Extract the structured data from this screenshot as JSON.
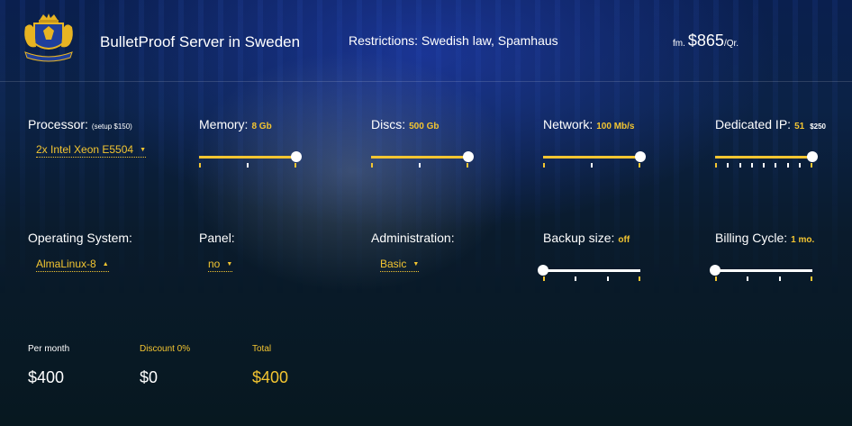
{
  "header": {
    "title": "BulletProof Server in Sweden",
    "restrictions": "Restrictions: Swedish law, Spamhaus",
    "price_prefix": "fm.",
    "price_amount": "$865",
    "price_period": "/Qr."
  },
  "config": {
    "processor": {
      "label": "Processor:",
      "note": "(setup $150)",
      "selected": "2x Intel Xeon E5504"
    },
    "memory": {
      "label": "Memory:",
      "value": "8 Gb",
      "level": 1.0
    },
    "discs": {
      "label": "Discs:",
      "value": "500 Gb",
      "level": 1.0
    },
    "network": {
      "label": "Network:",
      "value": "100 Mb/s",
      "level": 1.0
    },
    "dedicated_ip": {
      "label": "Dedicated IP:",
      "value": "51",
      "extra": "$250",
      "level": 1.0
    },
    "os": {
      "label": "Operating System:",
      "selected": "AlmaLinux-8"
    },
    "panel": {
      "label": "Panel:",
      "selected": "no"
    },
    "administration": {
      "label": "Administration:",
      "selected": "Basic"
    },
    "backup": {
      "label": "Backup size:",
      "value": "off",
      "level": 0.0
    },
    "billing": {
      "label": "Billing Cycle:",
      "value": "1 mo.",
      "level": 0.0
    }
  },
  "summary": {
    "per_month_label": "Per month",
    "per_month_value": "$400",
    "discount_label": "Discount 0%",
    "discount_value": "$0",
    "total_label": "Total",
    "total_value": "$400"
  },
  "colors": {
    "accent": "#f3c531",
    "background": "#0a1b2c"
  },
  "icons": {
    "logo": "royal-coat-of-arms-icon",
    "dropdown": "caret-down-icon",
    "dropdown_open": "caret-up-icon"
  }
}
